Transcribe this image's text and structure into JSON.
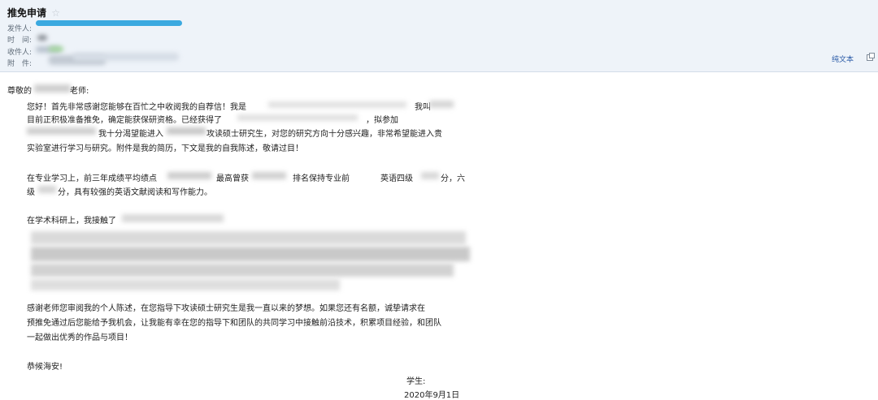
{
  "header": {
    "subject": "推免申请",
    "star_icon": "star-icon",
    "from_label": "发件人:",
    "time_label": "时　间:",
    "to_label": "收件人:",
    "attachment_label": "附　件:",
    "plain_text_link": "纯文本",
    "popout_icon": "popout-window-icon",
    "accent_color": "#3ba9e0"
  },
  "letter": {
    "salutation_start": "尊敬的",
    "salutation_end": "老师:",
    "p1_l1_a": "您好！首先非常感谢您能够在百忙之中收阅我的自荐信！我是",
    "p1_l1_b": "我叫",
    "p1_l2": "目前正积极准备推免，确定能获保研资格。已经获得了",
    "p1_l2_b": "，拟参加",
    "p1_l3_a": "我十分渴望能进入",
    "p1_l3_b": "攻读硕士研究生，对您的研究方向十分感兴趣，非常希望能进入贵",
    "p1_l4": "实验室进行学习与研究。附件是我的简历，下文是我的自我陈述，敬请过目！",
    "p2_l1_a": "在专业学习上，前三年成绩平均绩点",
    "p2_l1_b": "最高曾获",
    "p2_l1_c": "排名保持专业前",
    "p2_l1_d": "英语四级",
    "p2_l1_e": "分，六",
    "p2_l2_a": "级",
    "p2_l2_b": "分，具有较强的英语文献阅读和写作能力。",
    "p3_l1": "在学术科研上，我接触了",
    "p4_l1": "感谢老师您审阅我的个人陈述，在您指导下攻读硕士研究生是我一直以来的梦想。如果您还有名额，诚挚请求在",
    "p4_l2": "预推免通过后您能给予我机会，让我能有幸在您的指导下和团队的共同学习中接触前沿技术，积累项目经验，和团队",
    "p4_l3": "一起做出优秀的作品与项目！",
    "closing": "恭候海安!",
    "signature_label": "学生:",
    "date": "2020年9月1日"
  }
}
